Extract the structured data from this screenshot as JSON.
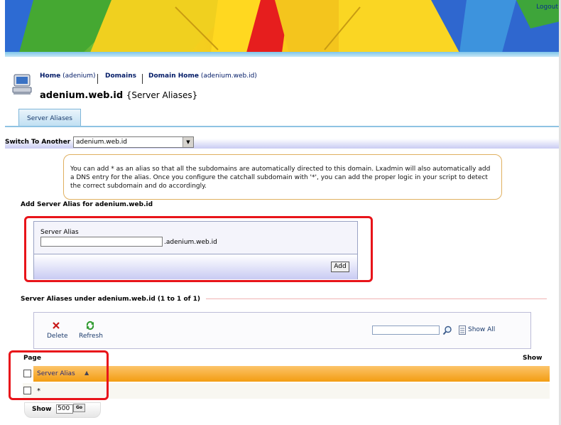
{
  "header": {
    "logout_label": "Logout"
  },
  "nav": {
    "home_label": "Home",
    "home_suffix": "(adenium)",
    "domains_label": "Domains",
    "domain_home_label": "Domain Home",
    "domain_home_suffix": "(adenium.web.id)"
  },
  "title": {
    "domain": "adenium.web.id",
    "section": "{Server Aliases}"
  },
  "tabs": [
    {
      "label": "Server Aliases"
    }
  ],
  "switch": {
    "label": "Switch To Another",
    "selected": "adenium.web.id"
  },
  "help_text": "You can add * as an alias so that all the subdomains are automatically directed to this domain. Lxadmin will also automatically add a DNS entry for the alias. Once you configure the catchall subdomain with '*', you can add the proper logic in your script to detect the correct subdomain and do accordingly.",
  "add_form": {
    "title": "Add Server Alias for adenium.web.id",
    "field_label": "Server Alias",
    "field_value": "",
    "suffix": ".adenium.web.id",
    "submit_label": "Add"
  },
  "list": {
    "title": "Server Aliases under adenium.web.id (1 to 1 of 1)",
    "toolbar": {
      "delete_label": "Delete",
      "refresh_label": "Refresh",
      "search_value": "",
      "show_all_label": "Show All"
    },
    "page_label": "Page",
    "show_label": "Show",
    "columns": [
      "Server Alias"
    ],
    "rows": [
      "*"
    ],
    "per_page_label": "Show",
    "per_page_value": "500",
    "go_label": "Go"
  },
  "icons": {
    "delete": "red-x-icon",
    "refresh": "green-refresh-icon",
    "search": "magnifier-icon",
    "show_all": "page-icon",
    "computer": "computer-icon",
    "sort": "sort-up-icon"
  },
  "colors": {
    "annotation_red": "#e8141a",
    "header_orange": "#f39d12",
    "nav_blue": "#001a66",
    "accent_lavender": "#c9cbf3"
  }
}
